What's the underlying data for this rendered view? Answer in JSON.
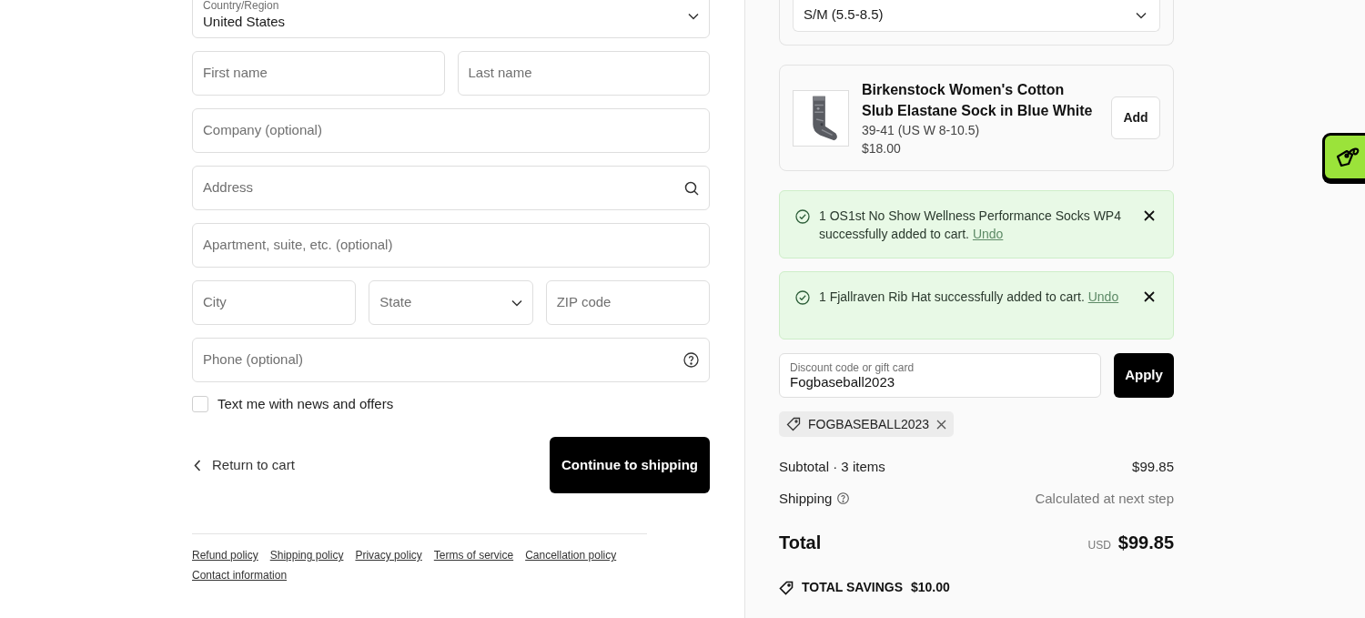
{
  "form": {
    "rows": [
      [
        {
          "kind": "select",
          "label": "Country/Region",
          "value": "United States"
        }
      ],
      [
        {
          "kind": "text",
          "placeholder": "First name"
        },
        {
          "kind": "text",
          "placeholder": "Last name"
        }
      ],
      [
        {
          "kind": "text",
          "placeholder": "Company (optional)"
        }
      ],
      [
        {
          "kind": "search",
          "placeholder": "Address"
        }
      ],
      [
        {
          "kind": "text",
          "placeholder": "Apartment, suite, etc. (optional)"
        }
      ],
      [
        {
          "kind": "text",
          "placeholder": "City"
        },
        {
          "kind": "select",
          "placeholder": "State"
        },
        {
          "kind": "text",
          "placeholder": "ZIP code"
        }
      ],
      [
        {
          "kind": "help",
          "placeholder": "Phone (optional)"
        }
      ]
    ],
    "marketing": {
      "label": "Text me with news and offers",
      "checked": false
    },
    "back_link": "Return to cart",
    "continue_button": "Continue to shipping"
  },
  "footer_links": [
    "Refund policy",
    "Shipping policy",
    "Privacy policy",
    "Terms of service",
    "Cancellation policy",
    "Contact information"
  ],
  "summary": {
    "variant_select": {
      "value": "S/M (5.5-8.5)"
    },
    "product": {
      "name": "Birkenstock Women's Cotton Slub Elastane Sock in Blue White",
      "variant": "39-41 (US W 8-10.5)",
      "price": "$18.00",
      "button": "Add"
    },
    "notices": [
      {
        "text": "1 OS1st No Show Wellness Performance Socks WP4 successfully added to cart.",
        "link": "Undo"
      },
      {
        "text": "1 Fjallraven Rib Hat successfully added to cart.",
        "link": "Undo"
      }
    ],
    "discount": {
      "label": "Discount code or gift card",
      "value": "Fogbaseball2023",
      "button": "Apply"
    },
    "applied_code": "FOGBASEBALL2023",
    "subtotal": {
      "label": "Subtotal · 3 items",
      "value": "$99.85"
    },
    "shipping": {
      "label": "Shipping",
      "value": "Calculated at next step"
    },
    "total": {
      "label": "Total",
      "currency": "USD",
      "value": "$99.85"
    },
    "savings": {
      "label": "TOTAL SAVINGS",
      "value": "$10.00"
    }
  }
}
